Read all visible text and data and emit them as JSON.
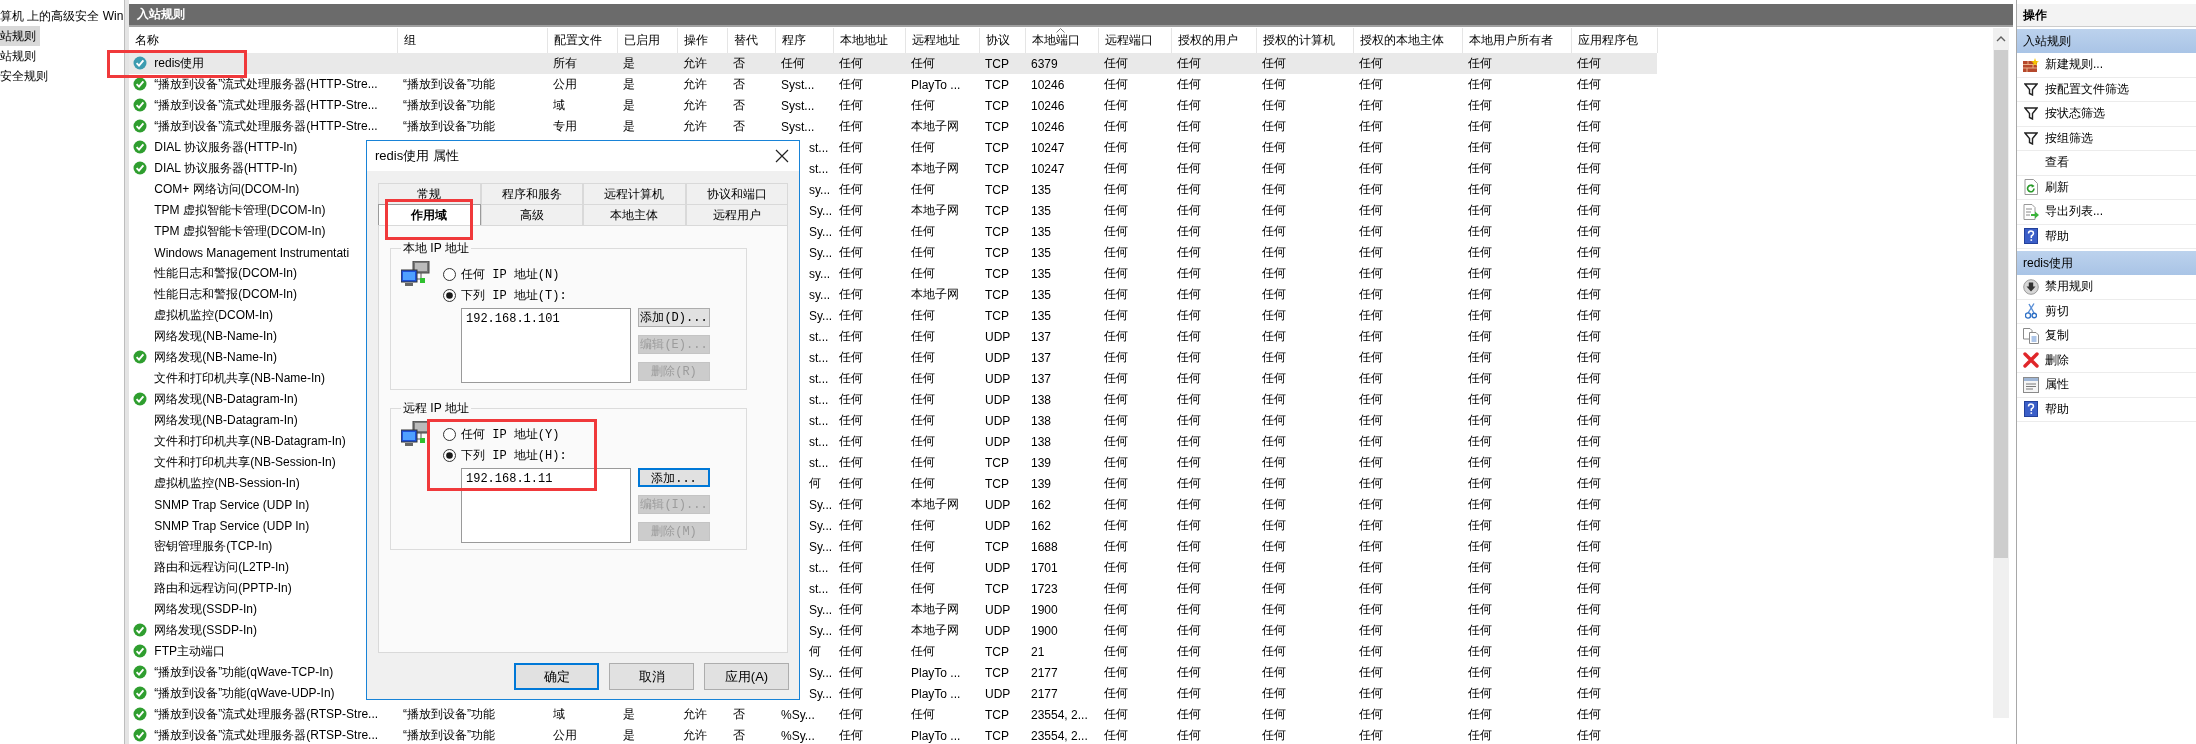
{
  "tree": {
    "items": [
      {
        "label": "算机 上的高级安全 Win",
        "selected": false
      },
      {
        "label": "站规则",
        "selected": true
      },
      {
        "label": "站规则",
        "selected": false
      },
      {
        "label": "安全规则",
        "selected": false
      }
    ]
  },
  "panel_title": "入站规则",
  "columns": [
    {
      "label": "名称",
      "sorted": false
    },
    {
      "label": "组",
      "sorted": false
    },
    {
      "label": "配置文件",
      "sorted": false
    },
    {
      "label": "已启用",
      "sorted": false
    },
    {
      "label": "操作",
      "sorted": false
    },
    {
      "label": "替代",
      "sorted": false
    },
    {
      "label": "程序",
      "sorted": false
    },
    {
      "label": "本地地址",
      "sorted": false
    },
    {
      "label": "远程地址",
      "sorted": false
    },
    {
      "label": "协议",
      "sorted": false
    },
    {
      "label": "本地端口",
      "sorted": true
    },
    {
      "label": "远程端口",
      "sorted": false
    },
    {
      "label": "授权的用户",
      "sorted": false
    },
    {
      "label": "授权的计算机",
      "sorted": false
    },
    {
      "label": "授权的本地主体",
      "sorted": false
    },
    {
      "label": "本地用户所有者",
      "sorted": false
    },
    {
      "label": "应用程序包",
      "sorted": false
    }
  ],
  "rows": [
    {
      "enabled": true,
      "selected": true,
      "cells": [
        "redis使用",
        null,
        "所有",
        "是",
        "允许",
        "否",
        "任何",
        "任何",
        "任何",
        "TCP",
        "6379",
        "任何",
        "任何",
        "任何",
        "任何",
        "任何",
        "任何"
      ]
    },
    {
      "enabled": true,
      "selected": false,
      "cells": [
        "“播放到设备”流式处理服务器(HTTP-Stre...",
        "“播放到设备”功能",
        "公用",
        "是",
        "允许",
        "否",
        "Syst...",
        "任何",
        "PlayTo ...",
        "TCP",
        "10246",
        "任何",
        "任何",
        "任何",
        "任何",
        "任何",
        "任何"
      ]
    },
    {
      "enabled": true,
      "selected": false,
      "cells": [
        "“播放到设备”流式处理服务器(HTTP-Stre...",
        "“播放到设备”功能",
        "域",
        "是",
        "允许",
        "否",
        "Syst...",
        "任何",
        "任何",
        "TCP",
        "10246",
        "任何",
        "任何",
        "任何",
        "任何",
        "任何",
        "任何"
      ]
    },
    {
      "enabled": true,
      "selected": false,
      "cells": [
        "“播放到设备”流式处理服务器(HTTP-Stre...",
        "“播放到设备”功能",
        "专用",
        "是",
        "允许",
        "否",
        "Syst...",
        "任何",
        "本地子网",
        "TCP",
        "10246",
        "任何",
        "任何",
        "任何",
        "任何",
        "任何",
        "任何"
      ]
    },
    {
      "enabled": true,
      "selected": false,
      "cells": [
        "DIAL 协议服务器(HTTP-In)",
        null,
        null,
        null,
        null,
        null,
        "st...",
        "任何",
        "任何",
        "TCP",
        "10247",
        "任何",
        "任何",
        "任何",
        "任何",
        "任何",
        "任何"
      ]
    },
    {
      "enabled": true,
      "selected": false,
      "cells": [
        "DIAL 协议服务器(HTTP-In)",
        null,
        null,
        null,
        null,
        null,
        "st...",
        "任何",
        "本地子网",
        "TCP",
        "10247",
        "任何",
        "任何",
        "任何",
        "任何",
        "任何",
        "任何"
      ]
    },
    {
      "enabled": false,
      "selected": false,
      "cells": [
        "COM+ 网络访问(DCOM-In)",
        null,
        null,
        null,
        null,
        null,
        "sy...",
        "任何",
        "任何",
        "TCP",
        "135",
        "任何",
        "任何",
        "任何",
        "任何",
        "任何",
        "任何"
      ]
    },
    {
      "enabled": false,
      "selected": false,
      "cells": [
        "TPM 虚拟智能卡管理(DCOM-In)",
        null,
        null,
        null,
        null,
        null,
        "Sy...",
        "任何",
        "本地子网",
        "TCP",
        "135",
        "任何",
        "任何",
        "任何",
        "任何",
        "任何",
        "任何"
      ]
    },
    {
      "enabled": false,
      "selected": false,
      "cells": [
        "TPM 虚拟智能卡管理(DCOM-In)",
        null,
        null,
        null,
        null,
        null,
        "Sy...",
        "任何",
        "任何",
        "TCP",
        "135",
        "任何",
        "任何",
        "任何",
        "任何",
        "任何",
        "任何"
      ]
    },
    {
      "enabled": false,
      "selected": false,
      "cells": [
        "Windows Management Instrumentati",
        null,
        null,
        null,
        null,
        null,
        "Sy...",
        "任何",
        "任何",
        "TCP",
        "135",
        "任何",
        "任何",
        "任何",
        "任何",
        "任何",
        "任何"
      ]
    },
    {
      "enabled": false,
      "selected": false,
      "cells": [
        "性能日志和警报(DCOM-In)",
        null,
        null,
        null,
        null,
        null,
        "sy...",
        "任何",
        "任何",
        "TCP",
        "135",
        "任何",
        "任何",
        "任何",
        "任何",
        "任何",
        "任何"
      ]
    },
    {
      "enabled": false,
      "selected": false,
      "cells": [
        "性能日志和警报(DCOM-In)",
        null,
        null,
        null,
        null,
        null,
        "sy...",
        "任何",
        "本地子网",
        "TCP",
        "135",
        "任何",
        "任何",
        "任何",
        "任何",
        "任何",
        "任何"
      ]
    },
    {
      "enabled": false,
      "selected": false,
      "cells": [
        "虚拟机监控(DCOM-In)",
        null,
        null,
        null,
        null,
        null,
        "Sy...",
        "任何",
        "任何",
        "TCP",
        "135",
        "任何",
        "任何",
        "任何",
        "任何",
        "任何",
        "任何"
      ]
    },
    {
      "enabled": false,
      "selected": false,
      "cells": [
        "网络发现(NB-Name-In)",
        null,
        null,
        null,
        null,
        null,
        "st...",
        "任何",
        "任何",
        "UDP",
        "137",
        "任何",
        "任何",
        "任何",
        "任何",
        "任何",
        "任何"
      ]
    },
    {
      "enabled": true,
      "selected": false,
      "cells": [
        "网络发现(NB-Name-In)",
        null,
        null,
        null,
        null,
        null,
        "st...",
        "任何",
        "任何",
        "UDP",
        "137",
        "任何",
        "任何",
        "任何",
        "任何",
        "任何",
        "任何"
      ]
    },
    {
      "enabled": false,
      "selected": false,
      "cells": [
        "文件和打印机共享(NB-Name-In)",
        null,
        null,
        null,
        null,
        null,
        "st...",
        "任何",
        "任何",
        "UDP",
        "137",
        "任何",
        "任何",
        "任何",
        "任何",
        "任何",
        "任何"
      ]
    },
    {
      "enabled": true,
      "selected": false,
      "cells": [
        "网络发现(NB-Datagram-In)",
        null,
        null,
        null,
        null,
        null,
        "st...",
        "任何",
        "任何",
        "UDP",
        "138",
        "任何",
        "任何",
        "任何",
        "任何",
        "任何",
        "任何"
      ]
    },
    {
      "enabled": false,
      "selected": false,
      "cells": [
        "网络发现(NB-Datagram-In)",
        null,
        null,
        null,
        null,
        null,
        "st...",
        "任何",
        "任何",
        "UDP",
        "138",
        "任何",
        "任何",
        "任何",
        "任何",
        "任何",
        "任何"
      ]
    },
    {
      "enabled": false,
      "selected": false,
      "cells": [
        "文件和打印机共享(NB-Datagram-In)",
        null,
        null,
        null,
        null,
        null,
        "st...",
        "任何",
        "任何",
        "UDP",
        "138",
        "任何",
        "任何",
        "任何",
        "任何",
        "任何",
        "任何"
      ]
    },
    {
      "enabled": false,
      "selected": false,
      "cells": [
        "文件和打印机共享(NB-Session-In)",
        null,
        null,
        null,
        null,
        null,
        "st...",
        "任何",
        "任何",
        "TCP",
        "139",
        "任何",
        "任何",
        "任何",
        "任何",
        "任何",
        "任何"
      ]
    },
    {
      "enabled": false,
      "selected": false,
      "cells": [
        "虚拟机监控(NB-Session-In)",
        null,
        null,
        null,
        null,
        null,
        "何",
        "任何",
        "任何",
        "TCP",
        "139",
        "任何",
        "任何",
        "任何",
        "任何",
        "任何",
        "任何"
      ]
    },
    {
      "enabled": false,
      "selected": false,
      "cells": [
        "SNMP Trap Service (UDP In)",
        null,
        null,
        null,
        null,
        null,
        "Sy...",
        "任何",
        "本地子网",
        "UDP",
        "162",
        "任何",
        "任何",
        "任何",
        "任何",
        "任何",
        "任何"
      ]
    },
    {
      "enabled": false,
      "selected": false,
      "cells": [
        "SNMP Trap Service (UDP In)",
        null,
        null,
        null,
        null,
        null,
        "Sy...",
        "任何",
        "任何",
        "UDP",
        "162",
        "任何",
        "任何",
        "任何",
        "任何",
        "任何",
        "任何"
      ]
    },
    {
      "enabled": false,
      "selected": false,
      "cells": [
        "密钥管理服务(TCP-In)",
        null,
        null,
        null,
        null,
        null,
        "Sy...",
        "任何",
        "任何",
        "TCP",
        "1688",
        "任何",
        "任何",
        "任何",
        "任何",
        "任何",
        "任何"
      ]
    },
    {
      "enabled": false,
      "selected": false,
      "cells": [
        "路由和远程访问(L2TP-In)",
        null,
        null,
        null,
        null,
        null,
        "st...",
        "任何",
        "任何",
        "UDP",
        "1701",
        "任何",
        "任何",
        "任何",
        "任何",
        "任何",
        "任何"
      ]
    },
    {
      "enabled": false,
      "selected": false,
      "cells": [
        "路由和远程访问(PPTP-In)",
        null,
        null,
        null,
        null,
        null,
        "st...",
        "任何",
        "任何",
        "TCP",
        "1723",
        "任何",
        "任何",
        "任何",
        "任何",
        "任何",
        "任何"
      ]
    },
    {
      "enabled": false,
      "selected": false,
      "cells": [
        "网络发现(SSDP-In)",
        null,
        null,
        null,
        null,
        null,
        "Sy...",
        "任何",
        "本地子网",
        "UDP",
        "1900",
        "任何",
        "任何",
        "任何",
        "任何",
        "任何",
        "任何"
      ]
    },
    {
      "enabled": true,
      "selected": false,
      "cells": [
        "网络发现(SSDP-In)",
        null,
        null,
        null,
        null,
        null,
        "Sy...",
        "任何",
        "本地子网",
        "UDP",
        "1900",
        "任何",
        "任何",
        "任何",
        "任何",
        "任何",
        "任何"
      ]
    },
    {
      "enabled": true,
      "selected": false,
      "cells": [
        "FTP主动端口",
        null,
        null,
        null,
        null,
        null,
        "何",
        "任何",
        "任何",
        "TCP",
        "21",
        "任何",
        "任何",
        "任何",
        "任何",
        "任何",
        "任何"
      ]
    },
    {
      "enabled": true,
      "selected": false,
      "cells": [
        "“播放到设备”功能(qWave-TCP-In)",
        null,
        null,
        null,
        null,
        null,
        "Sy...",
        "任何",
        "PlayTo ...",
        "TCP",
        "2177",
        "任何",
        "任何",
        "任何",
        "任何",
        "任何",
        "任何"
      ]
    },
    {
      "enabled": true,
      "selected": false,
      "cells": [
        "“播放到设备”功能(qWave-UDP-In)",
        null,
        null,
        null,
        null,
        null,
        "Sy...",
        "任何",
        "PlayTo ...",
        "UDP",
        "2177",
        "任何",
        "任何",
        "任何",
        "任何",
        "任何",
        "任何"
      ]
    },
    {
      "enabled": true,
      "selected": false,
      "cells": [
        "“播放到设备”流式处理服务器(RTSP-Stre...",
        "“播放到设备”功能",
        "域",
        "是",
        "允许",
        "否",
        "%Sy...",
        "任何",
        "任何",
        "TCP",
        "23554, 2...",
        "任何",
        "任何",
        "任何",
        "任何",
        "任何",
        "任何"
      ]
    },
    {
      "enabled": true,
      "selected": false,
      "cells": [
        "“播放到设备”流式处理服务器(RTSP-Stre...",
        "“播放到设备”功能",
        "公用",
        "是",
        "允许",
        "否",
        "%Sy...",
        "任何",
        "PlayTo ...",
        "TCP",
        "23554, 2...",
        "任何",
        "任何",
        "任何",
        "任何",
        "任何",
        "任何"
      ]
    }
  ],
  "actions": {
    "title": "操作",
    "sections": [
      {
        "title": "入站规则",
        "items": [
          {
            "label": "新建规则...",
            "kind": "new"
          },
          {
            "label": "按配置文件筛选",
            "kind": "filter"
          },
          {
            "label": "按状态筛选",
            "kind": "filter"
          },
          {
            "label": "按组筛选",
            "kind": "filter"
          },
          {
            "label": "查看",
            "kind": "plain"
          },
          {
            "label": "刷新",
            "kind": "refresh"
          },
          {
            "label": "导出列表...",
            "kind": "export"
          },
          {
            "label": "帮助",
            "kind": "help"
          }
        ]
      },
      {
        "title": "redis使用",
        "items": [
          {
            "label": "禁用规则",
            "kind": "disable"
          },
          {
            "label": "剪切",
            "kind": "cut"
          },
          {
            "label": "复制",
            "kind": "copy"
          },
          {
            "label": "删除",
            "kind": "delete"
          },
          {
            "label": "属性",
            "kind": "properties"
          },
          {
            "label": "帮助",
            "kind": "help"
          }
        ]
      }
    ]
  },
  "dialog": {
    "title": "redis使用 属性",
    "tab_rows": [
      [
        {
          "label": "常规",
          "selected": false
        },
        {
          "label": "程序和服务",
          "selected": false
        },
        {
          "label": "远程计算机",
          "selected": false
        },
        {
          "label": "协议和端口",
          "selected": false
        }
      ],
      [
        {
          "label": "作用域",
          "selected": true
        },
        {
          "label": "高级",
          "selected": false
        },
        {
          "label": "本地主体",
          "selected": false
        },
        {
          "label": "远程用户",
          "selected": false
        }
      ]
    ],
    "groups": [
      {
        "title": "本地 IP 地址",
        "radios": [
          {
            "label": "任何 IP 地址(N)",
            "selected": false
          },
          {
            "label": "下列 IP 地址(T):",
            "selected": true
          }
        ],
        "addresses": [
          "192.168.1.101"
        ],
        "buttons": [
          {
            "label": "添加(D)...",
            "disabled": false,
            "focused": false
          },
          {
            "label": "编辑(E)...",
            "disabled": true,
            "focused": false
          },
          {
            "label": "删除(R)",
            "disabled": true,
            "focused": false
          }
        ]
      },
      {
        "title": "远程 IP 地址",
        "radios": [
          {
            "label": "任何 IP 地址(Y)",
            "selected": false
          },
          {
            "label": "下列 IP 地址(H):",
            "selected": true
          }
        ],
        "addresses": [
          "192.168.1.11"
        ],
        "buttons": [
          {
            "label": "添加...",
            "disabled": false,
            "focused": true
          },
          {
            "label": "编辑(I)...",
            "disabled": true,
            "focused": false
          },
          {
            "label": "删除(M)",
            "disabled": true,
            "focused": false
          }
        ]
      }
    ],
    "buttons": [
      {
        "label": "确定",
        "focused": true
      },
      {
        "label": "取消",
        "focused": false
      },
      {
        "label": "应用(A)",
        "focused": false
      }
    ]
  }
}
